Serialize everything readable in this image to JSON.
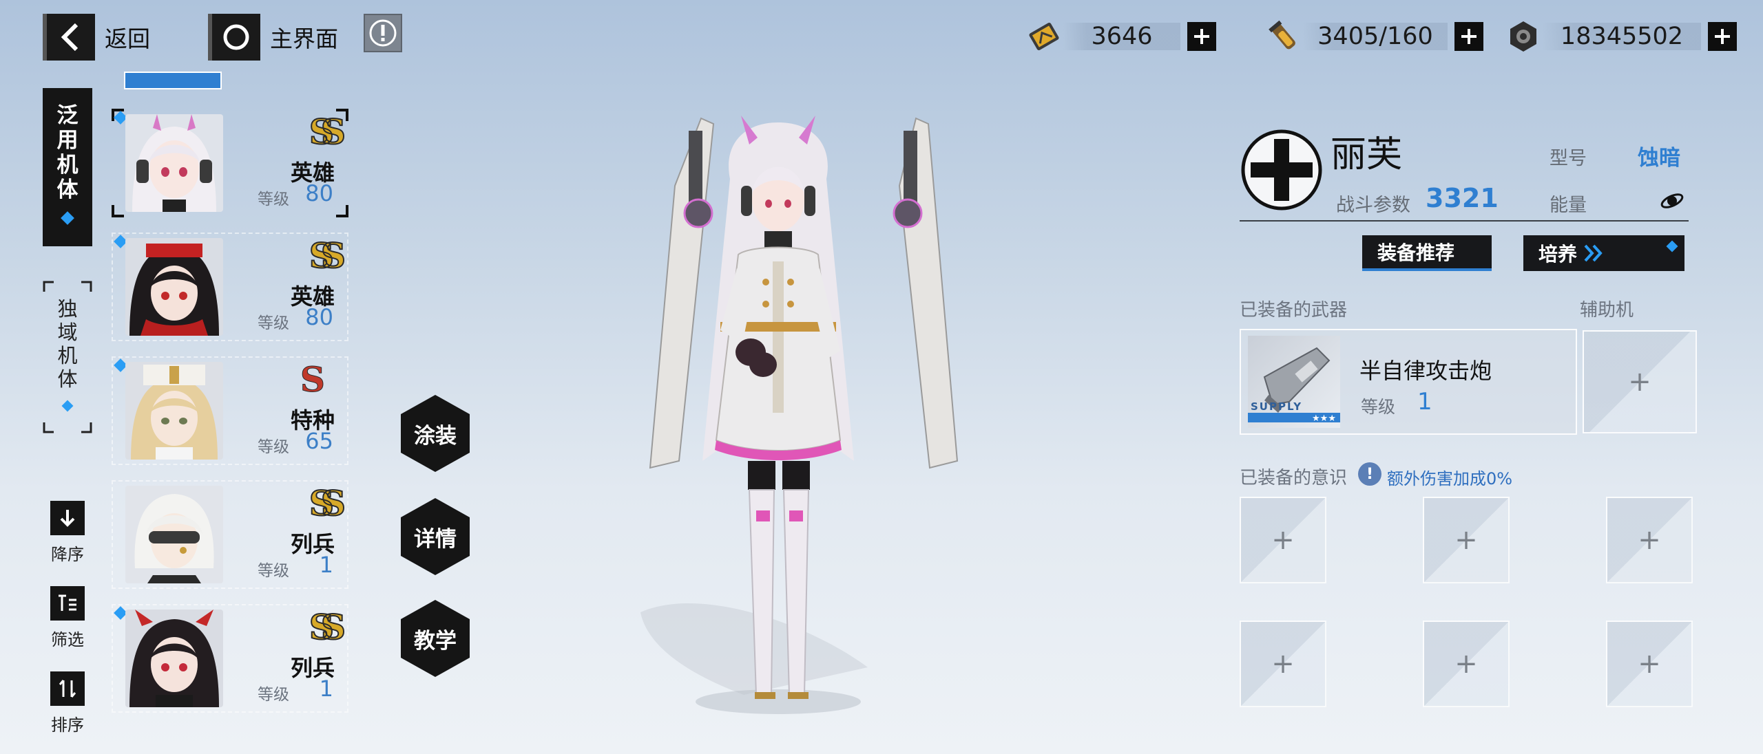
{
  "topbar": {
    "back_label": "返回",
    "home_label": "主界面",
    "resources": [
      {
        "icon": "stamina-card-icon",
        "value": "3646"
      },
      {
        "icon": "blood-vial-icon",
        "value": "3405/160"
      },
      {
        "icon": "hex-nut-coin-icon",
        "value": "18345502"
      }
    ]
  },
  "nav": {
    "tabs": [
      {
        "label": "泛用机体",
        "active": true
      },
      {
        "label": "独域机体",
        "active": false
      }
    ],
    "controls": [
      {
        "label": "降序",
        "icon": "arrow-down-icon"
      },
      {
        "label": "筛选",
        "icon": "filter-icon"
      },
      {
        "label": "排序",
        "icon": "sort-icon"
      }
    ]
  },
  "list": {
    "level_label": "等级",
    "items": [
      {
        "rank": "SS",
        "class": "英雄",
        "level": "80",
        "selected": true
      },
      {
        "rank": "SS",
        "class": "英雄",
        "level": "80",
        "selected": false
      },
      {
        "rank": "S",
        "class": "特种",
        "level": "65",
        "selected": false
      },
      {
        "rank": "SS",
        "class": "列兵",
        "level": "1",
        "selected": false
      },
      {
        "rank": "SS",
        "class": "列兵",
        "level": "1",
        "selected": false
      }
    ]
  },
  "actions": {
    "paint": "涂装",
    "details": "详情",
    "tutorial": "教学"
  },
  "character": {
    "name": "丽芙",
    "combat_label": "战斗参数",
    "combat_value": "3321",
    "model_label": "型号",
    "model_value": "蚀暗",
    "energy_label": "能量",
    "recommend_btn": "装备推荐",
    "cultivate_btn": "培养"
  },
  "weapon": {
    "section_label": "已装备的武器",
    "name": "半自律攻击炮",
    "level_label": "等级",
    "level_value": "1",
    "tag": "SUPPLY",
    "stars": "★★★"
  },
  "assist": {
    "section_label": "辅助机"
  },
  "memory": {
    "section_label": "已装备的意识",
    "bonus_text": "额外伤害加成0%"
  },
  "colors": {
    "accent_blue": "#2f7fd1",
    "dark": "#151515"
  }
}
